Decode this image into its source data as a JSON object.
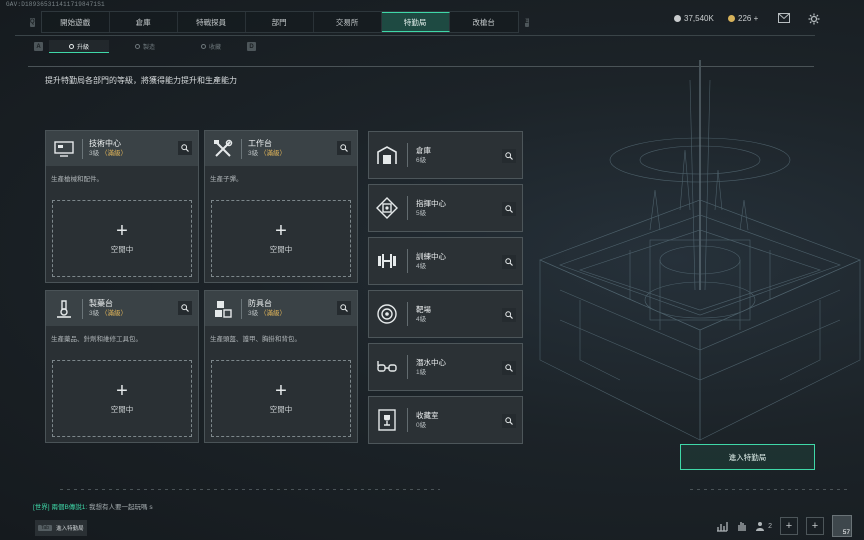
{
  "uid": "GAV:D1893653114117198471S1",
  "nav": {
    "left_key": "Q",
    "right_key": "E",
    "tabs": [
      {
        "label": "開始遊戲",
        "active": false
      },
      {
        "label": "倉庫",
        "active": false
      },
      {
        "label": "特戰探員",
        "active": false
      },
      {
        "label": "部門",
        "active": false
      },
      {
        "label": "交易所",
        "active": false
      },
      {
        "label": "特勤局",
        "active": true
      },
      {
        "label": "改槍台",
        "active": false
      }
    ]
  },
  "currency": {
    "primary": "37,540K",
    "secondary": "226 +",
    "primary_color": "#c9ccce",
    "secondary_color": "#d7b25a"
  },
  "subnav": {
    "left_key": "A",
    "right_key": "D",
    "tabs": [
      {
        "label": "升級",
        "active": true
      },
      {
        "label": "製造",
        "active": false
      },
      {
        "label": "收藏",
        "active": false
      }
    ]
  },
  "description": "提升特勤局各部門的等級，將獲得能力提升和生產能力",
  "production_cards": [
    {
      "name": "技術中心",
      "level": "3級",
      "badge": "（滿級）",
      "text": "生產槍械和配件。",
      "icon": "computer-icon",
      "slot_label": "空閒中"
    },
    {
      "name": "工作台",
      "level": "3級",
      "badge": "（滿級）",
      "text": "生產子彈。",
      "icon": "tools-icon",
      "slot_label": "空閒中"
    },
    {
      "name": "製藥台",
      "level": "3級",
      "badge": "（滿級）",
      "text": "生產藥品、針劑和維修工具包。",
      "icon": "microscope-icon",
      "slot_label": "空閒中"
    },
    {
      "name": "防具台",
      "level": "3級",
      "badge": "（滿級）",
      "text": "生產頭盔、護甲、胸掛和背包。",
      "icon": "armor-icon",
      "slot_label": "空閒中"
    }
  ],
  "facilities": [
    {
      "name": "倉庫",
      "level": "6級",
      "icon": "warehouse-icon"
    },
    {
      "name": "指揮中心",
      "level": "5級",
      "icon": "command-center-icon"
    },
    {
      "name": "訓練中心",
      "level": "4級",
      "icon": "dumbbell-icon"
    },
    {
      "name": "靶場",
      "level": "4級",
      "icon": "target-icon"
    },
    {
      "name": "潛水中心",
      "level": "1級",
      "icon": "diving-mask-icon"
    },
    {
      "name": "收藏室",
      "level": "0級",
      "icon": "trophy-cabinet-icon"
    }
  ],
  "enter_button": "進入特勤局",
  "chat": {
    "channel": "[世界]",
    "sender": "兩個B傳說1:",
    "message": "我想有人要一起玩嗎 s"
  },
  "tab_key": {
    "key": "Tab",
    "label": "進入特勤局"
  },
  "bottom": {
    "friends_count": "2",
    "avatar_level": "57"
  },
  "accent_color": "#3fd8a8",
  "max_color": "#e5b85a"
}
